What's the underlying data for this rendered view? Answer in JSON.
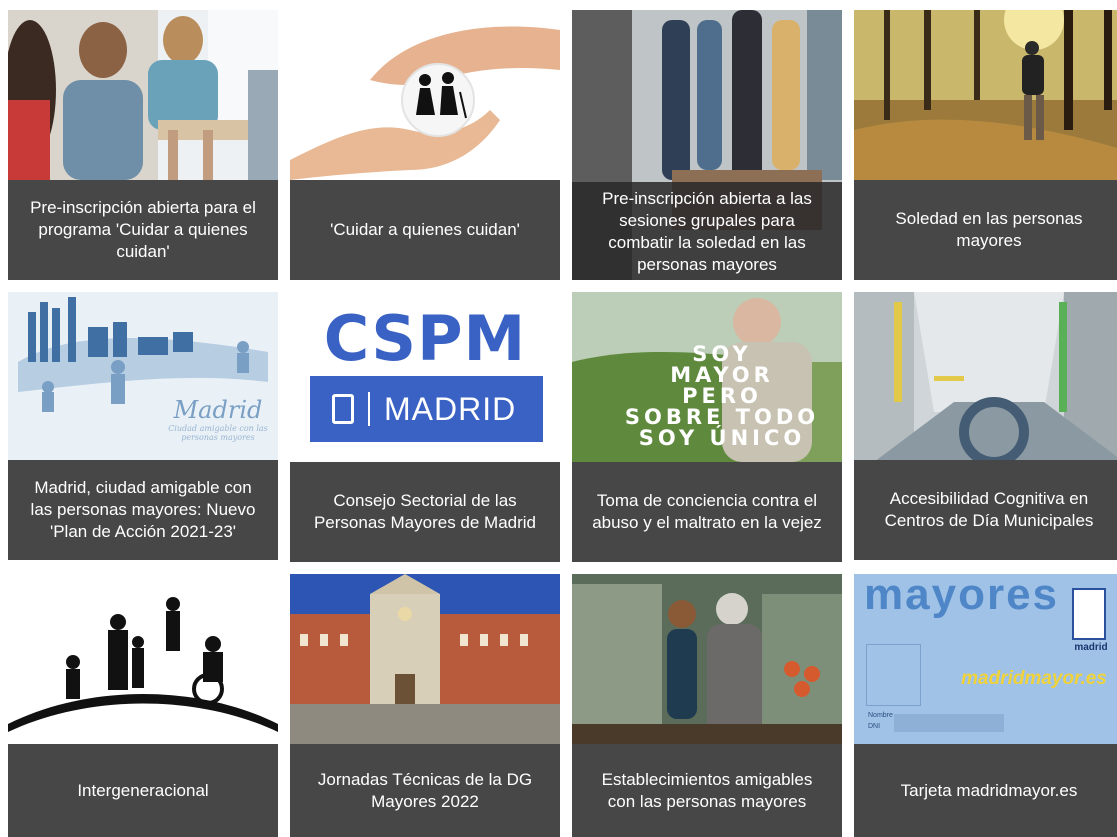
{
  "tiles": [
    {
      "caption": "Pre-inscripción abierta para el programa 'Cuidar a quienes cuidan'"
    },
    {
      "caption": "'Cuidar a quienes cuidan'"
    },
    {
      "caption": "Pre-inscripción abierta a las sesiones grupales para combatir la soledad en las personas mayores"
    },
    {
      "caption": "Soledad en las personas mayores"
    },
    {
      "caption": "Madrid, ciudad amigable con las personas mayores: Nuevo 'Plan de Acción 2021-23'",
      "image_text": {
        "script": "Madrid",
        "sub": "Ciudad amigable con las personas mayores"
      }
    },
    {
      "caption": "Consejo Sectorial de las Personas Mayores de Madrid",
      "image_text": {
        "logo": "CSPM",
        "city": "MADRID"
      }
    },
    {
      "caption": "Toma de conciencia contra el abuso y el maltrato en la vejez",
      "image_text": {
        "line1": "SOY",
        "line2": "MAYOR",
        "line3": "PERO",
        "line4": "SOBRE TODO",
        "line5": "SOY ÚNICO"
      }
    },
    {
      "caption": "Accesibilidad Cognitiva en Centros de Día Municipales"
    },
    {
      "caption": "Intergeneracional"
    },
    {
      "caption": "Jornadas Técnicas de la DG Mayores 2022"
    },
    {
      "caption": "Establecimientos amigables con las personas mayores"
    },
    {
      "caption": "Tarjeta madridmayor.es",
      "image_text": {
        "word": "mayores",
        "site": "madridmayor.es",
        "city": "madrid",
        "field1": "Nombre",
        "field2": "DNI"
      }
    }
  ],
  "colors": {
    "caption_bg": "#474747",
    "caption_text": "#ffffff",
    "cspm_blue": "#3a62c4"
  }
}
